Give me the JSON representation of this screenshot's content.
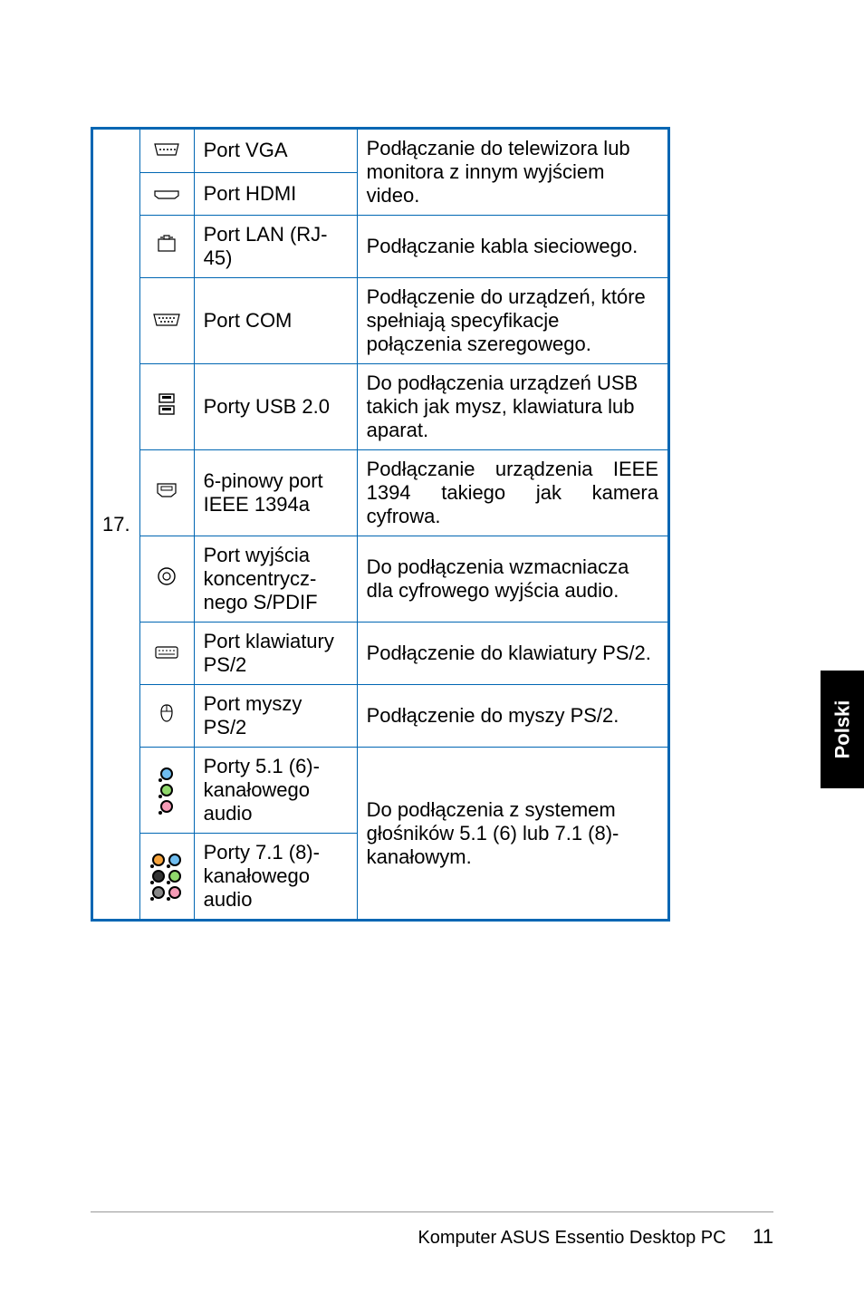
{
  "row_number": "17.",
  "rows": [
    {
      "icon": "vga",
      "name": "Port VGA",
      "desc": "Podłączanie do telewizora lub monitora z innym wyjściem video."
    },
    {
      "icon": "hdmi",
      "name": "Port HDMI",
      "desc": ""
    },
    {
      "icon": "lan",
      "name": "Port LAN (RJ-45)",
      "desc": "Podłączanie kabla sieciowego."
    },
    {
      "icon": "com",
      "name": "Port COM",
      "desc": "Podłączenie do urządzeń, które spełniają specyfikacje połączenia szeregowego."
    },
    {
      "icon": "usb",
      "name": "Porty USB 2.0",
      "desc": "Do podłączenia urządzeń USB takich jak mysz, klawiatura lub aparat."
    },
    {
      "icon": "1394",
      "name": "6-pinowy port IEEE 1394a",
      "desc": "Podłączanie urządzenia IEEE 1394 takiego jak kamera cyfrowa."
    },
    {
      "icon": "spdif",
      "name": "Port wyjścia koncentrycz­nego S/PDIF",
      "desc": "Do podłączenia wzmacniacza dla cyfrowego wyjścia audio."
    },
    {
      "icon": "ps2k",
      "name": "Port klawia­tury PS/2",
      "desc": "Podłączenie do klawiatury PS/2."
    },
    {
      "icon": "ps2m",
      "name": "Port myszy PS/2",
      "desc": "Podłączenie do myszy PS/2."
    },
    {
      "icon": "aud51",
      "name": "Porty 5.1 (6)-kanałowego audio",
      "desc": "Do podłączenia z systemem głośników 5.1 (6) lub 7.1 (8)-kanałowym."
    },
    {
      "icon": "aud71",
      "name": "Porty 7.1 (8)-kanałowego audio",
      "desc": ""
    }
  ],
  "audio_jack_colors_51": [
    "#6fbdf0",
    "#8fd86b",
    "#f59bb6"
  ],
  "audio_jack_colors_71": [
    [
      "#f7a33b",
      "#6fbdf0"
    ],
    [
      "#333333",
      "#8fd86b"
    ],
    [
      "#888888",
      "#f59bb6"
    ]
  ],
  "side_tab": "Polski",
  "footer_title": "Komputer ASUS Essentio Desktop PC",
  "page_number": "11"
}
